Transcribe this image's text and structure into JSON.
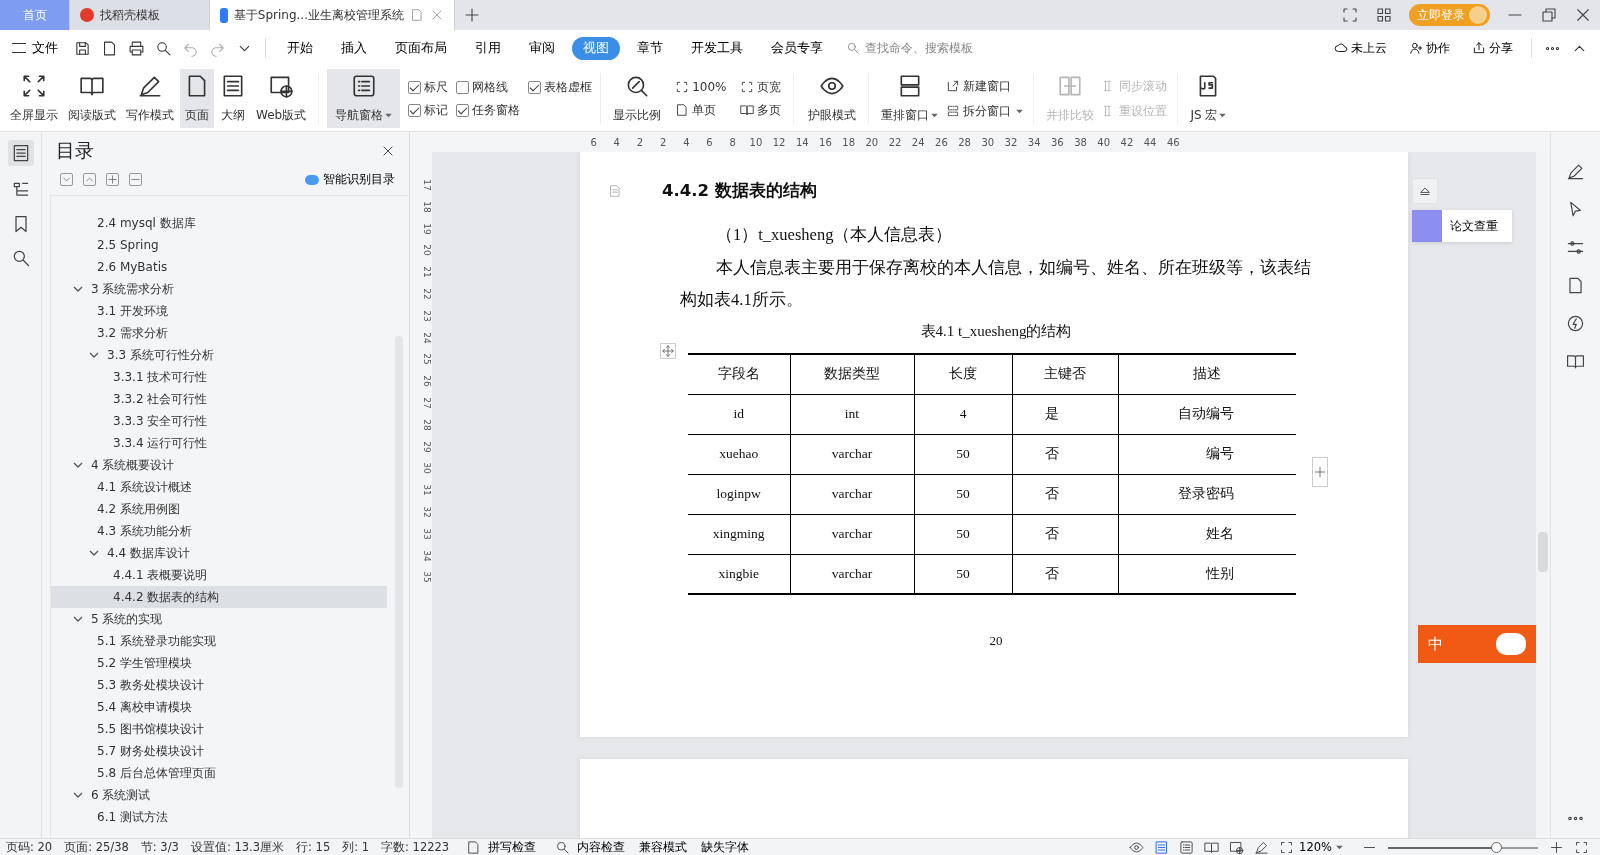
{
  "tabs": [
    {
      "label": "首页",
      "kind": "home",
      "selected": false
    },
    {
      "label": "找稻壳模板",
      "kind": "docer",
      "selected": false
    },
    {
      "label": "基于Spring...业生离校管理系统",
      "kind": "doc",
      "selected": true
    }
  ],
  "account": {
    "login": "立即登录"
  },
  "menu": {
    "file": "文件",
    "ribbon_tabs": [
      {
        "label": "开始",
        "selected": false
      },
      {
        "label": "插入",
        "selected": false
      },
      {
        "label": "页面布局",
        "selected": false
      },
      {
        "label": "引用",
        "selected": false
      },
      {
        "label": "审阅",
        "selected": false
      },
      {
        "label": "视图",
        "selected": true
      },
      {
        "label": "章节",
        "selected": false
      },
      {
        "label": "开发工具",
        "selected": false
      },
      {
        "label": "会员专享",
        "selected": false
      }
    ],
    "search": {
      "placeholder": "查找命令、搜索模板"
    },
    "actions": [
      "未上云",
      "协作",
      "分享"
    ]
  },
  "ribbon": {
    "views": [
      {
        "label": "全屏显示",
        "selected": false
      },
      {
        "label": "阅读版式",
        "selected": false
      },
      {
        "label": "写作模式",
        "selected": false
      },
      {
        "label": "页面",
        "selected": true
      },
      {
        "label": "大纲",
        "selected": false
      },
      {
        "label": "Web版式",
        "selected": false
      }
    ],
    "nav_pane": {
      "label": "导航窗格",
      "selected": true
    },
    "checkboxes": [
      {
        "label": "标尺",
        "checked": true
      },
      {
        "label": "网格线",
        "checked": false
      },
      {
        "label": "表格虚框",
        "checked": true
      },
      {
        "label": "标记",
        "checked": true
      },
      {
        "label": "任务窗格",
        "checked": true
      }
    ],
    "zoom": {
      "label": "显示比例",
      "options": [
        "100%",
        "页宽",
        "单页",
        "多页"
      ]
    },
    "eye_care": "护眼模式",
    "windows": {
      "rearrange": "重排窗口",
      "new": "新建窗口",
      "split": "拆分窗口"
    },
    "compare": [
      {
        "label": "并排比较",
        "disabled": true
      },
      {
        "label": "同步滚动",
        "disabled": true
      },
      {
        "label": "重设位置",
        "disabled": true
      }
    ],
    "macro": "JS 宏"
  },
  "toc": {
    "title": "目录",
    "smart": "智能识别目录",
    "items": [
      {
        "label": "2.4 mysql 数据库",
        "selected": false
      },
      {
        "label": "2.5 Spring",
        "selected": false
      },
      {
        "label": "2.6 MyBatis",
        "selected": false
      },
      {
        "label": "3  系统需求分析",
        "expanded": true,
        "selected": false,
        "children": [
          {
            "label": "3.1  开发环境",
            "selected": false
          },
          {
            "label": "3.2  需求分析",
            "selected": false
          },
          {
            "label": "3.3  系统可行性分析",
            "expanded": true,
            "selected": false,
            "children": [
              {
                "label": "3.3.1 技术可行性",
                "selected": false
              },
              {
                "label": "3.3.2 社会可行性",
                "selected": false
              },
              {
                "label": "3.3.3 安全可行性",
                "selected": false
              },
              {
                "label": "3.3.4 运行可行性",
                "selected": false
              }
            ]
          }
        ]
      },
      {
        "label": "4  系统概要设计",
        "expanded": true,
        "selected": false,
        "children": [
          {
            "label": "4.1  系统设计概述",
            "selected": false
          },
          {
            "label": "4.2  系统用例图",
            "selected": false
          },
          {
            "label": "4.3  系统功能分析",
            "selected": false
          },
          {
            "label": "4.4  数据库设计",
            "expanded": true,
            "selected": false,
            "children": [
              {
                "label": "4.4.1 表概要说明",
                "selected": false
              },
              {
                "label": "4.4.2  数据表的结构",
                "selected": true
              }
            ]
          }
        ]
      },
      {
        "label": "5    系统的实现",
        "expanded": true,
        "selected": false,
        "children": [
          {
            "label": "5.1  系统登录功能实现",
            "selected": false
          },
          {
            "label": "5.2  学生管理模块",
            "selected": false
          },
          {
            "label": "5.3  教务处模块设计",
            "selected": false
          },
          {
            "label": "5.4  离校申请模块",
            "selected": false
          },
          {
            "label": "5.5  图书馆模块设计",
            "selected": false
          },
          {
            "label": "5.7  财务处模块设计",
            "selected": false
          },
          {
            "label": "5.8  后台总体管理页面",
            "selected": false
          }
        ]
      },
      {
        "label": "6    系统测试",
        "expanded": true,
        "selected": false,
        "children": [
          {
            "label": "6.1  测试方法",
            "selected": false
          }
        ]
      }
    ]
  },
  "ruler": {
    "horizontal": [
      "6",
      "4",
      "2",
      "2",
      "4",
      "6",
      "8",
      "10",
      "12",
      "14",
      "16",
      "18",
      "20",
      "22",
      "24",
      "26",
      "28",
      "30",
      "32",
      "34",
      "36",
      "38",
      "40",
      "42",
      "44",
      "46"
    ],
    "vertical": [
      "17",
      "18",
      "19",
      "20",
      "21",
      "22",
      "23",
      "24",
      "25",
      "26",
      "27",
      "28",
      "29",
      "30",
      "31",
      "32",
      "33",
      "34",
      "35"
    ]
  },
  "document": {
    "heading": "4.4.2  数据表的结构",
    "subheading": "（1）t_xuesheng（本人信息表）",
    "paragraph": "本人信息表主要用于保存离校的本人信息，如编号、姓名、所在班级等，该表结构如表4.1所示。",
    "caption": "表4.1 t_xuesheng的结构",
    "table": {
      "columns": [
        "字段名",
        "数据类型",
        "长度",
        "主键否",
        "描述"
      ],
      "rows": [
        [
          "id",
          "int",
          "4",
          "是",
          "自动编号"
        ],
        [
          "xuehao",
          "varchar",
          "50",
          "否",
          "编号"
        ],
        [
          "loginpw",
          "varchar",
          "50",
          "否",
          "登录密码"
        ],
        [
          "xingming",
          "varchar",
          "50",
          "否",
          "姓名"
        ],
        [
          "xingbie",
          "varchar",
          "50",
          "否",
          "性别"
        ]
      ]
    },
    "page_number": "20"
  },
  "side_panel": {
    "check": "论文查重"
  },
  "ime": {
    "label": "中"
  },
  "status_bar": {
    "items": [
      "页码: 20",
      "页面: 25/38",
      "节: 3/3",
      "设置值: 13.3厘米",
      "行: 15",
      "列: 1",
      "字数: 12223"
    ],
    "tools": [
      "拼写检查",
      "内容检查",
      "兼容模式",
      "缺失字体"
    ],
    "zoom": "120%",
    "zoom_level": {
      "level": 0.72
    }
  }
}
